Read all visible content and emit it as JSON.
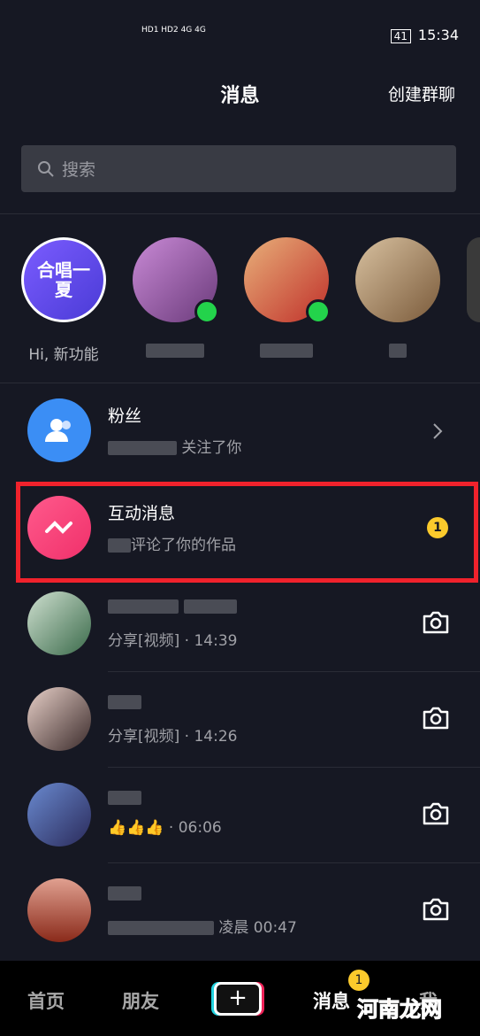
{
  "status_bar": {
    "network": "HD1 HD2 4G 4G",
    "battery": "41",
    "time": "15:34"
  },
  "header": {
    "title": "消息",
    "create_group": "创建群聊"
  },
  "search": {
    "placeholder": "搜索"
  },
  "stories": [
    {
      "label": "Hi, 新功能",
      "avatar_text": "合唱一夏"
    },
    {
      "label": "",
      "online": true
    },
    {
      "label": "",
      "online": true
    },
    {
      "label": ""
    }
  ],
  "rows": [
    {
      "name": "粉丝",
      "sub": "关注了你",
      "icon": "fans-icon",
      "action": "chevron-right-icon"
    },
    {
      "name": "互动消息",
      "sub": "评论了你的作品",
      "icon": "interaction-icon",
      "badge": "1",
      "highlighted": true
    },
    {
      "sub": "分享[视频] · 14:39",
      "action": "camera-icon"
    },
    {
      "sub": "分享[视频] · 14:26",
      "action": "camera-icon"
    },
    {
      "sub": "👍👍👍 · 06:06",
      "action": "camera-icon"
    },
    {
      "sub": "凌晨 00:47",
      "action": "camera-icon"
    }
  ],
  "tabbar": {
    "home": "首页",
    "friends": "朋友",
    "plus": "+",
    "messages": "消息",
    "messages_badge": "1",
    "me": "我"
  },
  "watermark": "河南龙网",
  "colors": {
    "background": "#161823",
    "highlight": "#f0222c",
    "badge": "#fbca2c",
    "online": "#23d34b"
  }
}
